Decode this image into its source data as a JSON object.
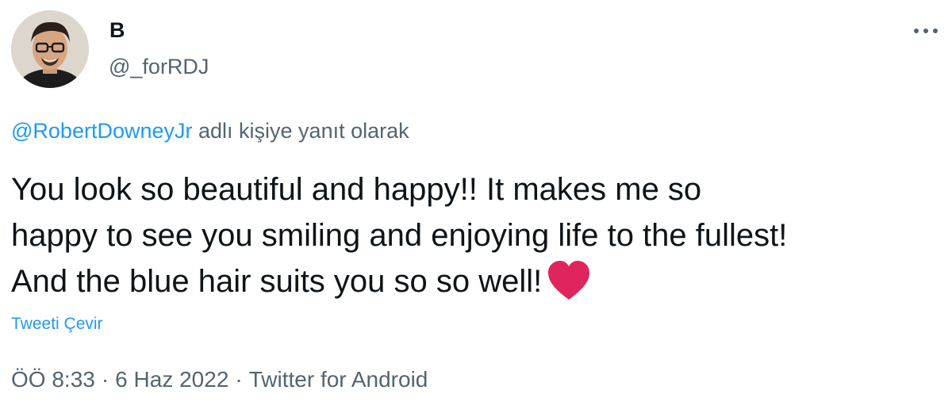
{
  "author": {
    "display_name": "B",
    "handle": "@_forRDJ",
    "avatar_icon": "profile-photo"
  },
  "more_icon": "more-horizontal-icon",
  "reply_context": {
    "mention": "@RobertDowneyJr",
    "suffix": " adlı kişiye yanıt olarak"
  },
  "tweet": {
    "lines": [
      "You look so beautiful and happy!! It makes me so",
      "happy to see you smiling and enjoying life to the fullest!",
      "And the blue hair suits you so so well!"
    ],
    "emoji": "heart-icon",
    "translate_label": "Tweeti Çevir"
  },
  "meta": {
    "time": "ÖÖ 8:33",
    "separator": "·",
    "date": "6 Haz 2022",
    "source": "Twitter for Android"
  },
  "colors": {
    "link": "#1d9bf0",
    "secondary_text": "#536471",
    "primary_text": "#0f1419",
    "heart": "#e0245e"
  }
}
